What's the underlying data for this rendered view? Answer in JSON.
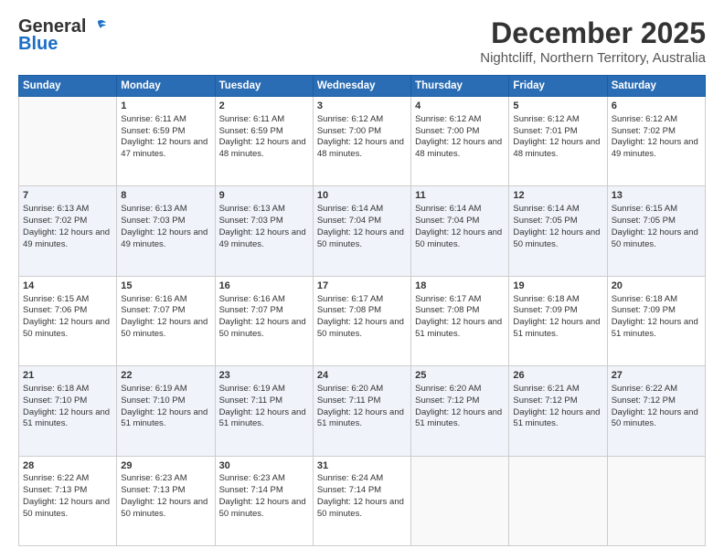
{
  "logo": {
    "line1": "General",
    "line2": "Blue"
  },
  "title": "December 2025",
  "location": "Nightcliff, Northern Territory, Australia",
  "weekdays": [
    "Sunday",
    "Monday",
    "Tuesday",
    "Wednesday",
    "Thursday",
    "Friday",
    "Saturday"
  ],
  "weeks": [
    [
      {
        "day": "",
        "sunrise": "",
        "sunset": "",
        "daylight": ""
      },
      {
        "day": "1",
        "sunrise": "Sunrise: 6:11 AM",
        "sunset": "Sunset: 6:59 PM",
        "daylight": "Daylight: 12 hours and 47 minutes."
      },
      {
        "day": "2",
        "sunrise": "Sunrise: 6:11 AM",
        "sunset": "Sunset: 6:59 PM",
        "daylight": "Daylight: 12 hours and 48 minutes."
      },
      {
        "day": "3",
        "sunrise": "Sunrise: 6:12 AM",
        "sunset": "Sunset: 7:00 PM",
        "daylight": "Daylight: 12 hours and 48 minutes."
      },
      {
        "day": "4",
        "sunrise": "Sunrise: 6:12 AM",
        "sunset": "Sunset: 7:00 PM",
        "daylight": "Daylight: 12 hours and 48 minutes."
      },
      {
        "day": "5",
        "sunrise": "Sunrise: 6:12 AM",
        "sunset": "Sunset: 7:01 PM",
        "daylight": "Daylight: 12 hours and 48 minutes."
      },
      {
        "day": "6",
        "sunrise": "Sunrise: 6:12 AM",
        "sunset": "Sunset: 7:02 PM",
        "daylight": "Daylight: 12 hours and 49 minutes."
      }
    ],
    [
      {
        "day": "7",
        "sunrise": "Sunrise: 6:13 AM",
        "sunset": "Sunset: 7:02 PM",
        "daylight": "Daylight: 12 hours and 49 minutes."
      },
      {
        "day": "8",
        "sunrise": "Sunrise: 6:13 AM",
        "sunset": "Sunset: 7:03 PM",
        "daylight": "Daylight: 12 hours and 49 minutes."
      },
      {
        "day": "9",
        "sunrise": "Sunrise: 6:13 AM",
        "sunset": "Sunset: 7:03 PM",
        "daylight": "Daylight: 12 hours and 49 minutes."
      },
      {
        "day": "10",
        "sunrise": "Sunrise: 6:14 AM",
        "sunset": "Sunset: 7:04 PM",
        "daylight": "Daylight: 12 hours and 50 minutes."
      },
      {
        "day": "11",
        "sunrise": "Sunrise: 6:14 AM",
        "sunset": "Sunset: 7:04 PM",
        "daylight": "Daylight: 12 hours and 50 minutes."
      },
      {
        "day": "12",
        "sunrise": "Sunrise: 6:14 AM",
        "sunset": "Sunset: 7:05 PM",
        "daylight": "Daylight: 12 hours and 50 minutes."
      },
      {
        "day": "13",
        "sunrise": "Sunrise: 6:15 AM",
        "sunset": "Sunset: 7:05 PM",
        "daylight": "Daylight: 12 hours and 50 minutes."
      }
    ],
    [
      {
        "day": "14",
        "sunrise": "Sunrise: 6:15 AM",
        "sunset": "Sunset: 7:06 PM",
        "daylight": "Daylight: 12 hours and 50 minutes."
      },
      {
        "day": "15",
        "sunrise": "Sunrise: 6:16 AM",
        "sunset": "Sunset: 7:07 PM",
        "daylight": "Daylight: 12 hours and 50 minutes."
      },
      {
        "day": "16",
        "sunrise": "Sunrise: 6:16 AM",
        "sunset": "Sunset: 7:07 PM",
        "daylight": "Daylight: 12 hours and 50 minutes."
      },
      {
        "day": "17",
        "sunrise": "Sunrise: 6:17 AM",
        "sunset": "Sunset: 7:08 PM",
        "daylight": "Daylight: 12 hours and 50 minutes."
      },
      {
        "day": "18",
        "sunrise": "Sunrise: 6:17 AM",
        "sunset": "Sunset: 7:08 PM",
        "daylight": "Daylight: 12 hours and 51 minutes."
      },
      {
        "day": "19",
        "sunrise": "Sunrise: 6:18 AM",
        "sunset": "Sunset: 7:09 PM",
        "daylight": "Daylight: 12 hours and 51 minutes."
      },
      {
        "day": "20",
        "sunrise": "Sunrise: 6:18 AM",
        "sunset": "Sunset: 7:09 PM",
        "daylight": "Daylight: 12 hours and 51 minutes."
      }
    ],
    [
      {
        "day": "21",
        "sunrise": "Sunrise: 6:18 AM",
        "sunset": "Sunset: 7:10 PM",
        "daylight": "Daylight: 12 hours and 51 minutes."
      },
      {
        "day": "22",
        "sunrise": "Sunrise: 6:19 AM",
        "sunset": "Sunset: 7:10 PM",
        "daylight": "Daylight: 12 hours and 51 minutes."
      },
      {
        "day": "23",
        "sunrise": "Sunrise: 6:19 AM",
        "sunset": "Sunset: 7:11 PM",
        "daylight": "Daylight: 12 hours and 51 minutes."
      },
      {
        "day": "24",
        "sunrise": "Sunrise: 6:20 AM",
        "sunset": "Sunset: 7:11 PM",
        "daylight": "Daylight: 12 hours and 51 minutes."
      },
      {
        "day": "25",
        "sunrise": "Sunrise: 6:20 AM",
        "sunset": "Sunset: 7:12 PM",
        "daylight": "Daylight: 12 hours and 51 minutes."
      },
      {
        "day": "26",
        "sunrise": "Sunrise: 6:21 AM",
        "sunset": "Sunset: 7:12 PM",
        "daylight": "Daylight: 12 hours and 51 minutes."
      },
      {
        "day": "27",
        "sunrise": "Sunrise: 6:22 AM",
        "sunset": "Sunset: 7:12 PM",
        "daylight": "Daylight: 12 hours and 50 minutes."
      }
    ],
    [
      {
        "day": "28",
        "sunrise": "Sunrise: 6:22 AM",
        "sunset": "Sunset: 7:13 PM",
        "daylight": "Daylight: 12 hours and 50 minutes."
      },
      {
        "day": "29",
        "sunrise": "Sunrise: 6:23 AM",
        "sunset": "Sunset: 7:13 PM",
        "daylight": "Daylight: 12 hours and 50 minutes."
      },
      {
        "day": "30",
        "sunrise": "Sunrise: 6:23 AM",
        "sunset": "Sunset: 7:14 PM",
        "daylight": "Daylight: 12 hours and 50 minutes."
      },
      {
        "day": "31",
        "sunrise": "Sunrise: 6:24 AM",
        "sunset": "Sunset: 7:14 PM",
        "daylight": "Daylight: 12 hours and 50 minutes."
      },
      {
        "day": "",
        "sunrise": "",
        "sunset": "",
        "daylight": ""
      },
      {
        "day": "",
        "sunrise": "",
        "sunset": "",
        "daylight": ""
      },
      {
        "day": "",
        "sunrise": "",
        "sunset": "",
        "daylight": ""
      }
    ]
  ]
}
